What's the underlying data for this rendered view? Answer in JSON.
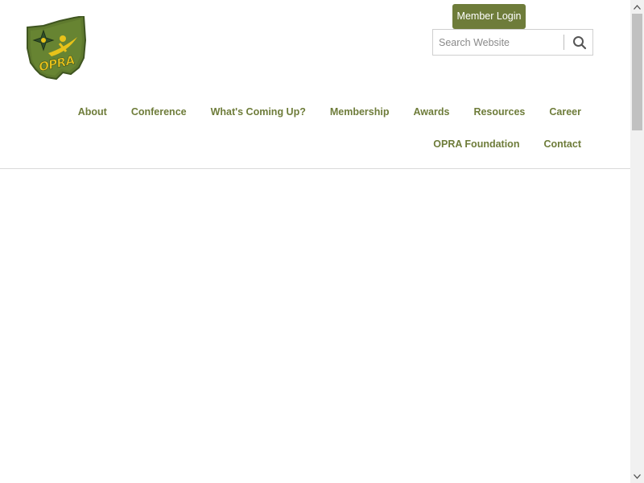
{
  "header": {
    "logo": {
      "alt": "OPRA",
      "logo_text": "OPRA",
      "colors": {
        "shape": "#5f7a2e",
        "shape_dark": "#3f5520",
        "accent": "#e8c21a"
      }
    },
    "member_login_label": "Member Login",
    "search": {
      "placeholder": "Search Website",
      "value": "",
      "icon": "search-icon"
    },
    "nav_primary": [
      {
        "label": "About"
      },
      {
        "label": "Conference"
      },
      {
        "label": "What's Coming Up?"
      },
      {
        "label": "Membership"
      },
      {
        "label": "Awards"
      },
      {
        "label": "Resources"
      },
      {
        "label": "Career"
      }
    ],
    "nav_secondary": [
      {
        "label": "OPRA Foundation"
      },
      {
        "label": "Contact"
      }
    ]
  },
  "colors": {
    "accent": "#6e7c3a",
    "nav_text": "#6e7c3a",
    "background": "#ffffff",
    "divider": "#d9d9d9"
  }
}
